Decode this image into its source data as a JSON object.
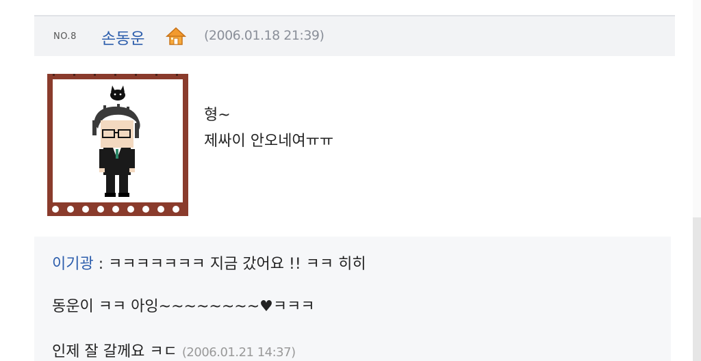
{
  "post": {
    "number": "NO.8",
    "author": "손동운",
    "home_icon": "home-icon",
    "date": "(2006.01.18 21:39)",
    "body": "형~\n제싸이 안오네여ㅠㅠ"
  },
  "comment": {
    "author": "이기광",
    "separator": ":",
    "line1_text": "ㅋㅋㅋㅋㅋㅋㅋ 지금 갔어요 !! ㅋㅋ 히히",
    "line2_text": "동운이 ㅋㅋ 아잉~~~~~~~~♥ㅋㅋㅋ",
    "line3_text": "인제 잘 갈께요 ㅋㄷ",
    "date": "(2006.01.21 14:37)"
  },
  "colors": {
    "link_blue": "#2c5dac",
    "header_bg": "#f2f3f5",
    "frame_brown": "#8a3b2c"
  }
}
